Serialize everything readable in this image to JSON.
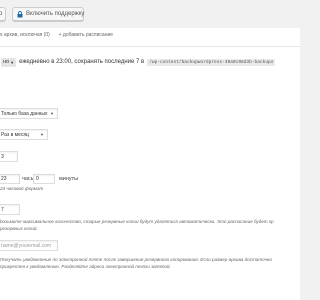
{
  "toolbar": {
    "partial_button_label": "io",
    "support_button_label": "Включить поддержку"
  },
  "schedule_bar": {
    "text": "s архив, исключая (0)",
    "add_label": "+ добавить расписание"
  },
  "summary": {
    "toggle_label": "но",
    "text": "ежедневно в 23:00, сохранять последние 7 в",
    "path": "/wp-content/backupwordpress-49a0c98d3b-backups"
  },
  "red_label": "",
  "backup_type": {
    "selected": "Только база данных"
  },
  "frequency": {
    "selected": "Раз в месяц"
  },
  "day_input": {
    "value": "3"
  },
  "time": {
    "hours_value": "23",
    "hours_label": "часы",
    "minutes_value": "0",
    "minutes_label": "минуты",
    "hint": "24 часовой формат"
  },
  "keep": {
    "value": "7",
    "hint_line1": "bозьмите максимальное количество, старые резервные копии будут удаляться автоматически. Это расписание будет хр",
    "hint_line2": "резервных копий."
  },
  "email": {
    "placeholder": "name@youremail.com",
    "hint_line1": "Получать уведомление по электронной почте после завершения резервного копирования. Если размер архива достаточно",
    "hint_line2": "прикреплен к уведомлению. Разделяйте адреса электронной почты запятой."
  },
  "colors": {
    "page_bg": "#f1f1f1",
    "panel_bg": "#ffffff",
    "alert_red": "#dc3232"
  }
}
